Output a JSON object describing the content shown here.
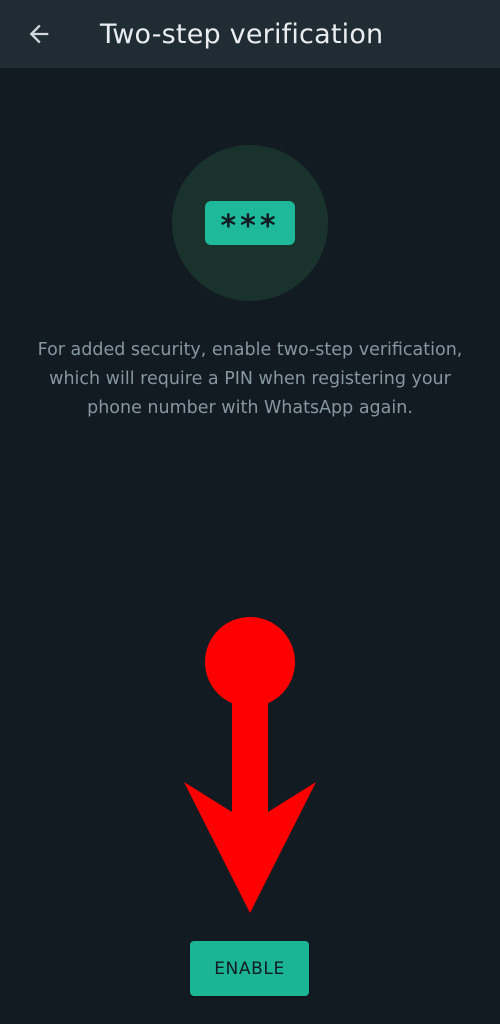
{
  "header": {
    "back_icon": "arrow-back-icon",
    "title": "Two-step verification"
  },
  "illustration": {
    "pin_text": "***"
  },
  "description": "For added security, enable two-step verification, which will require a PIN when registering your phone number with WhatsApp again.",
  "enable_button": {
    "label": "ENABLE"
  },
  "annotation": {
    "type": "arrow-pointing-down",
    "color": "#ff0000"
  },
  "colors": {
    "background": "#121b22",
    "app_bar": "#1f2c34",
    "accent": "#1bb495",
    "illustration_circle": "#19322c",
    "secondary_text": "#8696a0",
    "primary_text": "#e9edef"
  }
}
